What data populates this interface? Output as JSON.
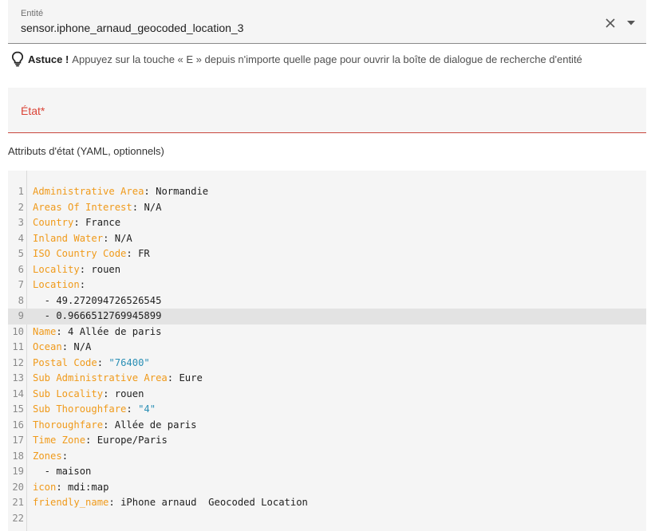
{
  "entity_field": {
    "label": "Entité",
    "value": "sensor.iphone_arnaud_geocoded_location_3"
  },
  "tip": {
    "strong": "Astuce !",
    "text": "Appuyez sur la touche « E » depuis n'importe quelle page pour ouvrir la boîte de dialogue de recherche d'entité"
  },
  "state_field": {
    "label": "État*"
  },
  "attributes_label": "Attributs d'état (YAML, optionnels)",
  "icons": {
    "clear": "close-icon",
    "dropdown": "caret-down-icon",
    "tip": "lightbulb-icon"
  },
  "colors": {
    "yaml_key": "#f09a1a",
    "yaml_string": "#2a8fb5",
    "error_red": "#db4437"
  },
  "yaml_lines": [
    {
      "n": "1",
      "key": "Administrative Area",
      "sep": ": ",
      "value": "Normandie",
      "type": "plain"
    },
    {
      "n": "2",
      "key": "Areas Of Interest",
      "sep": ": ",
      "value": "N/A",
      "type": "plain"
    },
    {
      "n": "3",
      "key": "Country",
      "sep": ": ",
      "value": "France",
      "type": "plain"
    },
    {
      "n": "4",
      "key": "Inland Water",
      "sep": ": ",
      "value": "N/A",
      "type": "plain"
    },
    {
      "n": "5",
      "key": "ISO Country Code",
      "sep": ": ",
      "value": "FR",
      "type": "plain"
    },
    {
      "n": "6",
      "key": "Locality",
      "sep": ": ",
      "value": "rouen",
      "type": "plain"
    },
    {
      "n": "7",
      "key": "Location",
      "sep": ":",
      "value": "",
      "type": "plain"
    },
    {
      "n": "8",
      "key": "",
      "sep": "",
      "value": "  - 49.272094726526545",
      "type": "plain"
    },
    {
      "n": "9",
      "key": "",
      "sep": "",
      "value": "  - 0.9666512769945899",
      "type": "plain"
    },
    {
      "n": "10",
      "key": "Name",
      "sep": ": ",
      "value": "4 Allée de paris",
      "type": "plain"
    },
    {
      "n": "11",
      "key": "Ocean",
      "sep": ": ",
      "value": "N/A",
      "type": "plain"
    },
    {
      "n": "12",
      "key": "Postal Code",
      "sep": ": ",
      "value": "\"76400\"",
      "type": "string"
    },
    {
      "n": "13",
      "key": "Sub Administrative Area",
      "sep": ": ",
      "value": "Eure",
      "type": "plain"
    },
    {
      "n": "14",
      "key": "Sub Locality",
      "sep": ": ",
      "value": "rouen",
      "type": "plain"
    },
    {
      "n": "15",
      "key": "Sub Thoroughfare",
      "sep": ": ",
      "value": "\"4\"",
      "type": "string"
    },
    {
      "n": "16",
      "key": "Thoroughfare",
      "sep": ": ",
      "value": "Allée de paris",
      "type": "plain"
    },
    {
      "n": "17",
      "key": "Time Zone",
      "sep": ": ",
      "value": "Europe/Paris",
      "type": "plain"
    },
    {
      "n": "18",
      "key": "Zones",
      "sep": ":",
      "value": "",
      "type": "plain"
    },
    {
      "n": "19",
      "key": "",
      "sep": "",
      "value": "  - maison",
      "type": "plain"
    },
    {
      "n": "20",
      "key": "icon",
      "sep": ": ",
      "value": "mdi:map",
      "type": "plain"
    },
    {
      "n": "21",
      "key": "friendly_name",
      "sep": ": ",
      "value": "iPhone arnaud  Geocoded Location",
      "type": "plain"
    },
    {
      "n": "22",
      "key": "",
      "sep": "",
      "value": "",
      "type": "plain"
    }
  ],
  "active_line": 8
}
